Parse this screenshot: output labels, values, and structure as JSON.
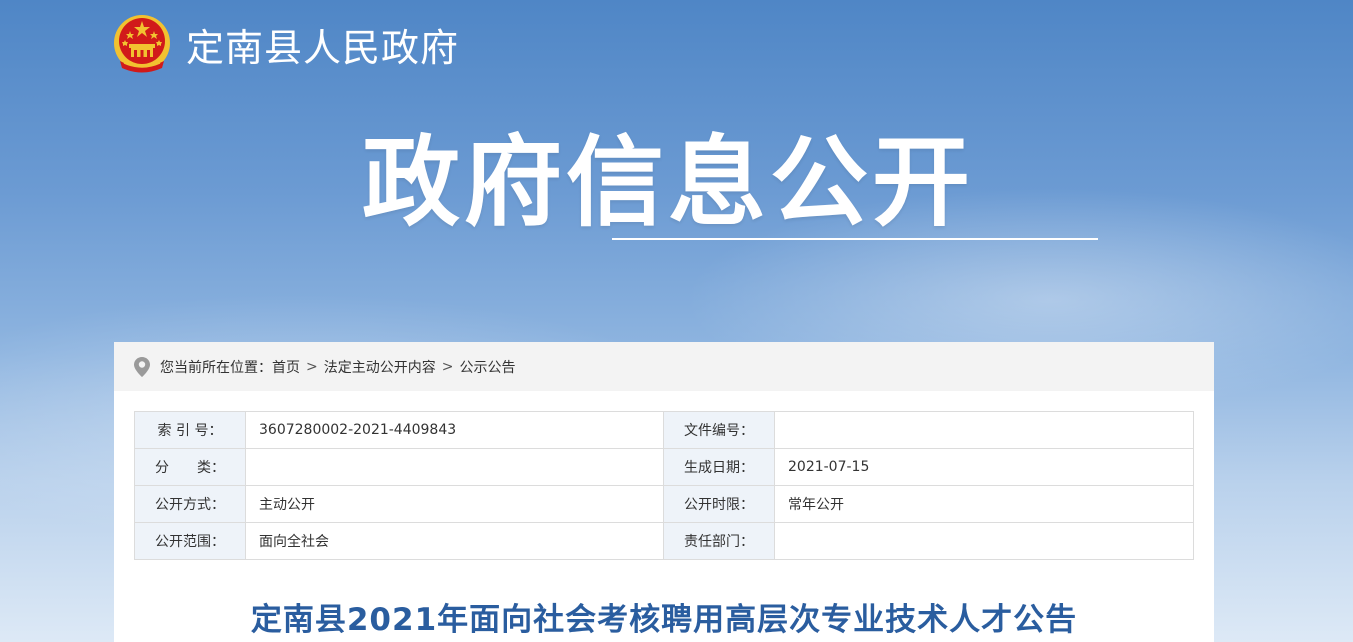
{
  "header": {
    "site_name": "定南县人民政府",
    "emblem_icon": "national-emblem-icon"
  },
  "hero": {
    "title": "政府信息公开"
  },
  "breadcrumb": {
    "icon": "location-pin-icon",
    "prefix": "您当前所在位置：",
    "items": [
      "首页",
      "法定主动公开内容",
      "公示公告"
    ],
    "separator": ">"
  },
  "metadata": {
    "rows": [
      {
        "left_label": "索 引 号：",
        "left_value": "3607280002-2021-4409843",
        "right_label": "文件编号：",
        "right_value": ""
      },
      {
        "left_label": "分　　类：",
        "left_value": "",
        "right_label": "生成日期：",
        "right_value": "2021-07-15"
      },
      {
        "left_label": "公开方式：",
        "left_value": "主动公开",
        "right_label": "公开时限：",
        "right_value": "常年公开"
      },
      {
        "left_label": "公开范围：",
        "left_value": "面向全社会",
        "right_label": "责任部门：",
        "right_value": ""
      }
    ]
  },
  "article": {
    "title": "定南县2021年面向社会考核聘用高层次专业技术人才公告"
  },
  "colors": {
    "title_blue": "#2a5d9f",
    "label_bg": "#eef3f9",
    "emblem_red": "#d11a1a",
    "emblem_gold": "#f2c230"
  }
}
